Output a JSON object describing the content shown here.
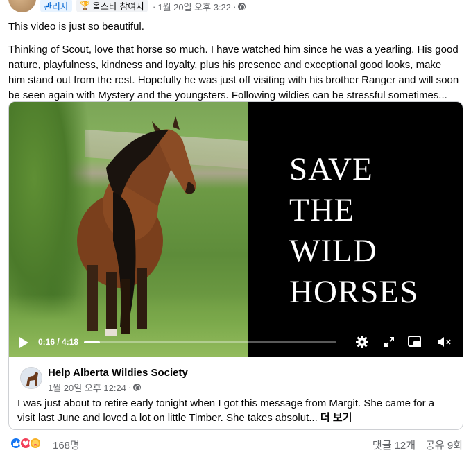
{
  "header": {
    "admin_badge": "관리자",
    "allstar_badge": "올스타 참여자",
    "separator": "·",
    "timestamp": "1월 20일 오후 3:22",
    "separator2": "·"
  },
  "post": {
    "paragraph1": "This video is just so beautiful.",
    "paragraph2": "Thinking of Scout, love that horse so much. I have watched him since he was a yearling. His good nature, playfulness, kindness and loyalty, plus his presence and exceptional good looks, make him stand out from the rest. Hopefully he was just off visiting with his brother Ranger and will soon be seen again with Mystery and the youngsters. Following wildies can be stressful sometimes..."
  },
  "video": {
    "slogan": [
      "SAVE",
      "THE",
      "WILD",
      "HORSES"
    ],
    "current_time": "0:16",
    "time_separator": " / ",
    "duration": "4:18",
    "progress_fraction": 0.062,
    "icons": [
      "play-icon",
      "settings-gear-icon",
      "fullscreen-icon",
      "picture-in-picture-icon",
      "muted-speaker-icon"
    ]
  },
  "shared_post": {
    "page_name": "Help Alberta Wildies Society",
    "timestamp": "1월 20일 오후 12:24",
    "separator": "·",
    "text": "I was just about to retire early tonight when I got this message from Margit. She came for a visit last June and loved a lot on little Timber. She takes absolut...",
    "see_more": "더 보기"
  },
  "footer": {
    "reaction_count": "168명",
    "comments": "댓글 12개",
    "shares": "공유 9회"
  },
  "colors": {
    "accent": "#0064d1",
    "like": "#1877f2",
    "love": "#f33e58",
    "care": "#f7b125",
    "secondary_text": "#65676b"
  }
}
